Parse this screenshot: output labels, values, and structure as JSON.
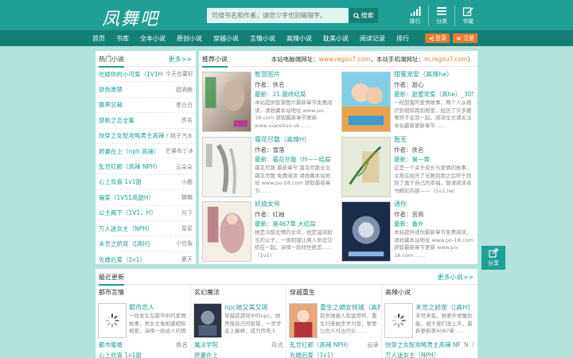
{
  "header": {
    "logo": "凤舞吧",
    "search_placeholder": "可搜书名和作者，请您少字也别输错字。",
    "search_button": "搜索",
    "icons": [
      {
        "icon": "signal-icon",
        "label": "排行"
      },
      {
        "icon": "menu-icon",
        "label": "分类"
      },
      {
        "icon": "edit-icon",
        "label": "书架"
      }
    ]
  },
  "nav": {
    "items": [
      "首页",
      "书库",
      "全本小说",
      "原创小说",
      "穿越小说",
      "言情小说",
      "高辣小说",
      "耽美小说",
      "阅读记录",
      "排行"
    ],
    "login": "登录",
    "register": "注册"
  },
  "left": {
    "title": "热门小说",
    "more": "更多>>",
    "rows": [
      {
        "title": "吃掉你的小可爱（1V1H",
        "author": "今天也要好好吃饭"
      },
      {
        "title": "欲色难禁",
        "author": "甜酒酿"
      },
      {
        "title": "腹黑总裁",
        "author": "墨白白"
      },
      {
        "title": "禁断之恋全集",
        "author": "佚名"
      },
      {
        "title": "快穿之女配攻略男主高辣 np （h）",
        "author": "桃子汽水"
      },
      {
        "title": "娇妻在上（nph 高辣）",
        "author": "芒果布丁冰沙"
      },
      {
        "title": "乱世红颜（高辣 NPH）",
        "author": "云朵朵"
      },
      {
        "title": "心上欢喜 1v1甜",
        "author": "小鹿"
      },
      {
        "title": "偏爱（1VS1高甜H）",
        "author": "糖糖"
      },
      {
        "title": "公主殿下（1V1，H）",
        "author": "月下"
      },
      {
        "title": "万人迷女主（NPH）",
        "author": "星星"
      },
      {
        "title": "末世之娇宠（[高H]",
        "author": "小白兔"
      },
      {
        "title": "先婚后爱（1v1）",
        "author": "夏天"
      }
    ]
  },
  "center": {
    "title": "推荐小说",
    "notice_prefix": "本站电脑端网址：",
    "notice_url1": "www.regou7.com",
    "notice_mid": "，本站手机端网址：",
    "notice_url2": "m.regou7.com",
    "notice_suffix": "）",
    "books": [
      {
        "title": "智慧图片",
        "author": "作者：佚名",
        "latest": "最新：21.最终结局",
        "desc": "本站提供智慧图片最新章节免费阅读，请收藏本站地址 www.po-18.com 获取最新章节更新 www.xiaoshuo.uk ……"
      },
      {
        "title": "甜蜜宠爱（高辣he）",
        "author": "作者：甜心",
        "latest": "最新：甜蜜宠爱（高he）_305",
        "desc": "一段甜蜜的爱情故事，两个人从相识到相知再到相爱，经历了许多磨难终于走到一起，阅读全文请关注本站最新更新章节……"
      },
      {
        "title": "霜花尽散（高辣H）",
        "author": "作者：雪落",
        "latest": "最新：霜花尽散（H——结局",
        "desc": "霜花尽散 最新章节 霜花尽散全文 霜花尽散 免费阅读 请收藏本站地址 www.po-18.com 获取最新章节……"
      },
      {
        "title": "暂无",
        "author": "作者：佚名",
        "latest": "最新：第一章",
        "desc": "这是一个关于成长与爱情的故事，主角在经历了无数风雨之后终于找到了属于自己的幸福，敬请阅读本书精彩内容——（1v1,he）"
      },
      {
        "title": "妖娆女帝",
        "author": "作者：红袖",
        "latest": "最新：第467章 大结局",
        "desc": "她是冷酷无情的女帝，他是温润如玉的公子，一场阴谋让两人命运交织在一起，演绎一段倾世绝恋……（1v1)"
      },
      {
        "title": "诱你",
        "author": "作者：宫商",
        "latest": "最新：番外",
        "desc": "本站提供诱你最新章节免费阅读，请收藏本站地址 www.po-18.com 获取最新章节更新 www.po-18.com ……"
      }
    ]
  },
  "bottom": {
    "title": "最近更新",
    "more": "更多小说>>",
    "cols": [
      {
        "title": "都市言情",
        "book": "都市恋人",
        "desc": "一段发生在都市中的爱情故事，男女主角相遇相知相爱，演绎一段动人的情缘……",
        "row": {
          "t": "都市暖婚",
          "a": "佚名"
        }
      },
      {
        "title": "玄幻魔法",
        "book": "npc她又美又飒",
        "desc": "穿越成游戏中的npc，她凭借自己的智慧，一步步走上巅峰，成为传奇人物……",
        "row": {
          "t": "魔法学院",
          "a": "月光"
        }
      },
      {
        "title": "穿越重生",
        "book": "重生之嫡女倾城（高辣）",
        "desc": "前世她被人陷害惨死，重生归来她步步为营，誓要让仇人付出代价……",
        "row": {
          "t": "乱世红颜（高辣 NPH）",
          "a": "云朵"
        }
      },
      {
        "title": "高辣小说",
        "book": "末世之娇宠（[高H]",
        "desc": "末世来临，她意外觉醒异能，被大佬们宠上天，最新更新第4087章……",
        "row": {
          "t": "快穿之女配攻略男主高辣 NP（",
          "a": "N（"
        }
      }
    ],
    "row2": [
      "心上欢喜 1v1甜",
      "娇妻在上",
      "先婚后爱（1v1）",
      "万人迷女主（NPH）"
    ]
  },
  "share": {
    "label": "分享"
  }
}
